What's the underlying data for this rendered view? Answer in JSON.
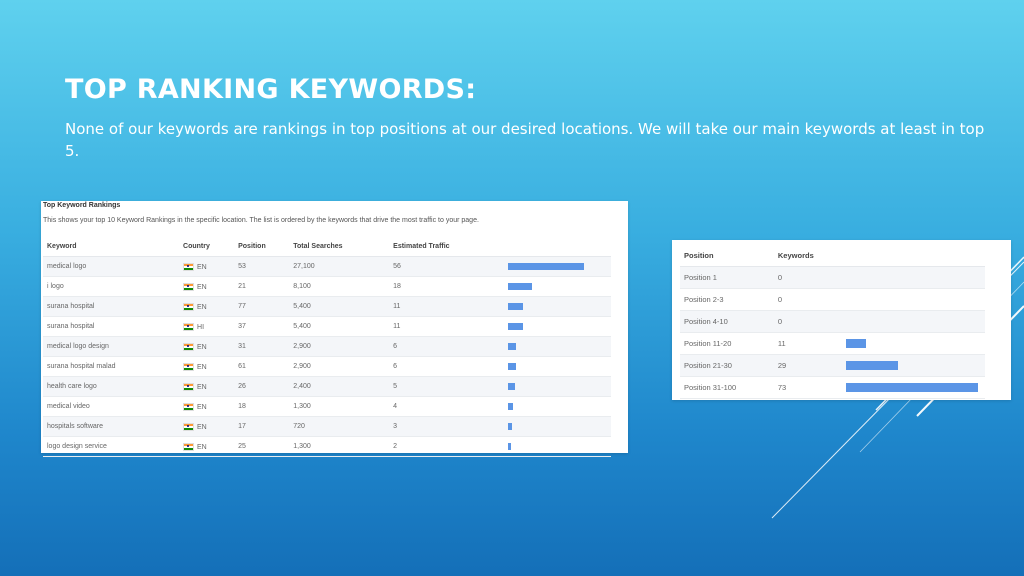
{
  "slide": {
    "title": "TOP RANKING KEYWORDS:",
    "subtitle": "None of our keywords are rankings in top positions at our desired locations. We will take our main keywords at least in top 5."
  },
  "rankings_panel": {
    "title": "Top Keyword Rankings",
    "description": "This shows your top 10 Keyword Rankings in the specific location. The list is ordered by the keywords that drive the most traffic to your page.",
    "columns": {
      "keyword": "Keyword",
      "country": "Country",
      "position": "Position",
      "total_searches": "Total Searches",
      "estimated_traffic": "Estimated Traffic"
    },
    "rows": [
      {
        "keyword": "medical logo",
        "country": "EN",
        "position": "53",
        "total_searches": "27,100",
        "estimated_traffic": "56",
        "traffic_value": 56
      },
      {
        "keyword": "i logo",
        "country": "EN",
        "position": "21",
        "total_searches": "8,100",
        "estimated_traffic": "18",
        "traffic_value": 18
      },
      {
        "keyword": "surana hospital",
        "country": "EN",
        "position": "77",
        "total_searches": "5,400",
        "estimated_traffic": "11",
        "traffic_value": 11
      },
      {
        "keyword": "surana hospital",
        "country": "HI",
        "position": "37",
        "total_searches": "5,400",
        "estimated_traffic": "11",
        "traffic_value": 11
      },
      {
        "keyword": "medical logo design",
        "country": "EN",
        "position": "31",
        "total_searches": "2,900",
        "estimated_traffic": "6",
        "traffic_value": 6
      },
      {
        "keyword": "surana hospital malad",
        "country": "EN",
        "position": "61",
        "total_searches": "2,900",
        "estimated_traffic": "6",
        "traffic_value": 6
      },
      {
        "keyword": "health care logo",
        "country": "EN",
        "position": "26",
        "total_searches": "2,400",
        "estimated_traffic": "5",
        "traffic_value": 5
      },
      {
        "keyword": "medical video",
        "country": "EN",
        "position": "18",
        "total_searches": "1,300",
        "estimated_traffic": "4",
        "traffic_value": 4
      },
      {
        "keyword": "hospitals software",
        "country": "EN",
        "position": "17",
        "total_searches": "720",
        "estimated_traffic": "3",
        "traffic_value": 3
      },
      {
        "keyword": "logo design service",
        "country": "EN",
        "position": "25",
        "total_searches": "1,300",
        "estimated_traffic": "2",
        "traffic_value": 2
      }
    ],
    "bar_max": 56
  },
  "positions_panel": {
    "columns": {
      "position": "Position",
      "keywords": "Keywords"
    },
    "rows": [
      {
        "position": "Position 1",
        "keywords": "0",
        "value": 0
      },
      {
        "position": "Position 2-3",
        "keywords": "0",
        "value": 0
      },
      {
        "position": "Position 4-10",
        "keywords": "0",
        "value": 0
      },
      {
        "position": "Position 11-20",
        "keywords": "11",
        "value": 11
      },
      {
        "position": "Position 21-30",
        "keywords": "29",
        "value": 29
      },
      {
        "position": "Position 31-100",
        "keywords": "73",
        "value": 73
      }
    ],
    "bar_max": 73
  },
  "colors": {
    "bar": "#5b95e6",
    "title": "#ffffff"
  },
  "icons": {
    "flag": "india-flag-icon"
  }
}
